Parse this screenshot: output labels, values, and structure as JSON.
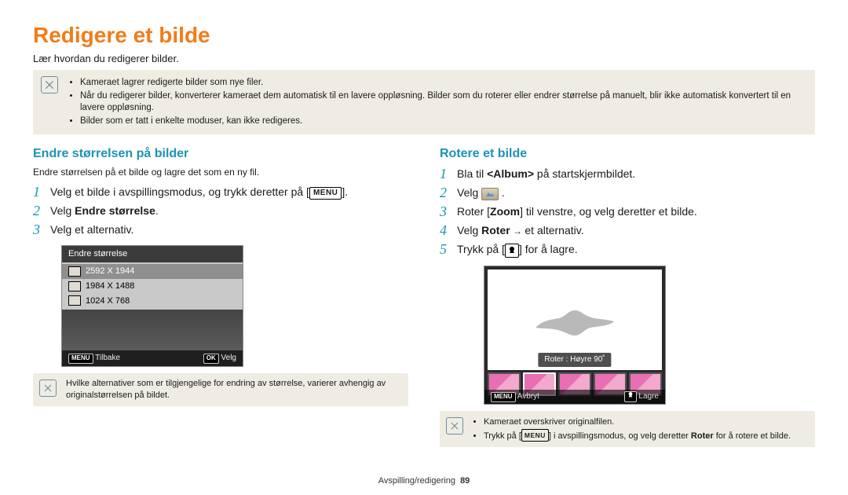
{
  "title": "Redigere et bilde",
  "intro": "Lær hvordan du redigerer bilder.",
  "top_note": {
    "items": [
      "Kameraet lagrer redigerte bilder som nye filer.",
      "Når du redigerer bilder, konverterer kameraet dem automatisk til en lavere oppløsning. Bilder som du roterer eller endrer størrelse på manuelt, blir ikke automatisk konvertert til en lavere oppløsning.",
      "Bilder som er tatt i enkelte moduser, kan ikke redigeres."
    ]
  },
  "left": {
    "heading": "Endre størrelsen på bilder",
    "subintro": "Endre størrelsen på et bilde og lagre det som en ny fil.",
    "step1_pre": "Velg et bilde i avspillingsmodus, og trykk deretter på [",
    "step1_btn": "MENU",
    "step1_post": "].",
    "step2_pre": "Velg ",
    "step2_bold": "Endre størrelse",
    "step2_post": ".",
    "step3": "Velg et alternativ.",
    "screen": {
      "title": "Endre størrelse",
      "rows": [
        "2592 X 1944",
        "1984 X 1488",
        "1024 X 768"
      ],
      "foot_left_btn": "MENU",
      "foot_left": "Tilbake",
      "foot_right_btn": "OK",
      "foot_right": "Velg"
    },
    "note": "Hvilke alternativer som er tilgjengelige for endring av størrelse, varierer avhengig av originalstørrelsen på bildet."
  },
  "right": {
    "heading": "Rotere et bilde",
    "step1_pre": "Bla til ",
    "step1_bold": "<Album>",
    "step1_post": " på startskjermbildet.",
    "step2_pre": "Velg ",
    "step2_post": " .",
    "step3_pre": "Roter [",
    "step3_bold": "Zoom",
    "step3_post": "] til venstre, og velg deretter et bilde.",
    "step4_pre": "Velg ",
    "step4_bold": "Roter",
    "step4_arrow": " → ",
    "step4_post": "et alternativ.",
    "step5_pre": "Trykk på [",
    "step5_post": "] for å lagre.",
    "screen": {
      "tooltip": "Roter : Høyre 90˚",
      "foot_left_btn": "MENU",
      "foot_left": "Avbryt",
      "foot_right": "Lagre"
    },
    "note": {
      "items": [
        "Kameraet overskriver originalfilen.",
        "Trykk på [MENU] i avspillingsmodus, og velg deretter Roter for å rotere et bilde."
      ],
      "menu_btn": "MENU",
      "item2_pre": "Trykk på [",
      "item2_mid": "] i avspillingsmodus, og velg deretter ",
      "item2_bold": "Roter",
      "item2_post": " for å rotere et bilde."
    }
  },
  "footer": {
    "section": "Avspilling/redigering",
    "page": "89"
  }
}
